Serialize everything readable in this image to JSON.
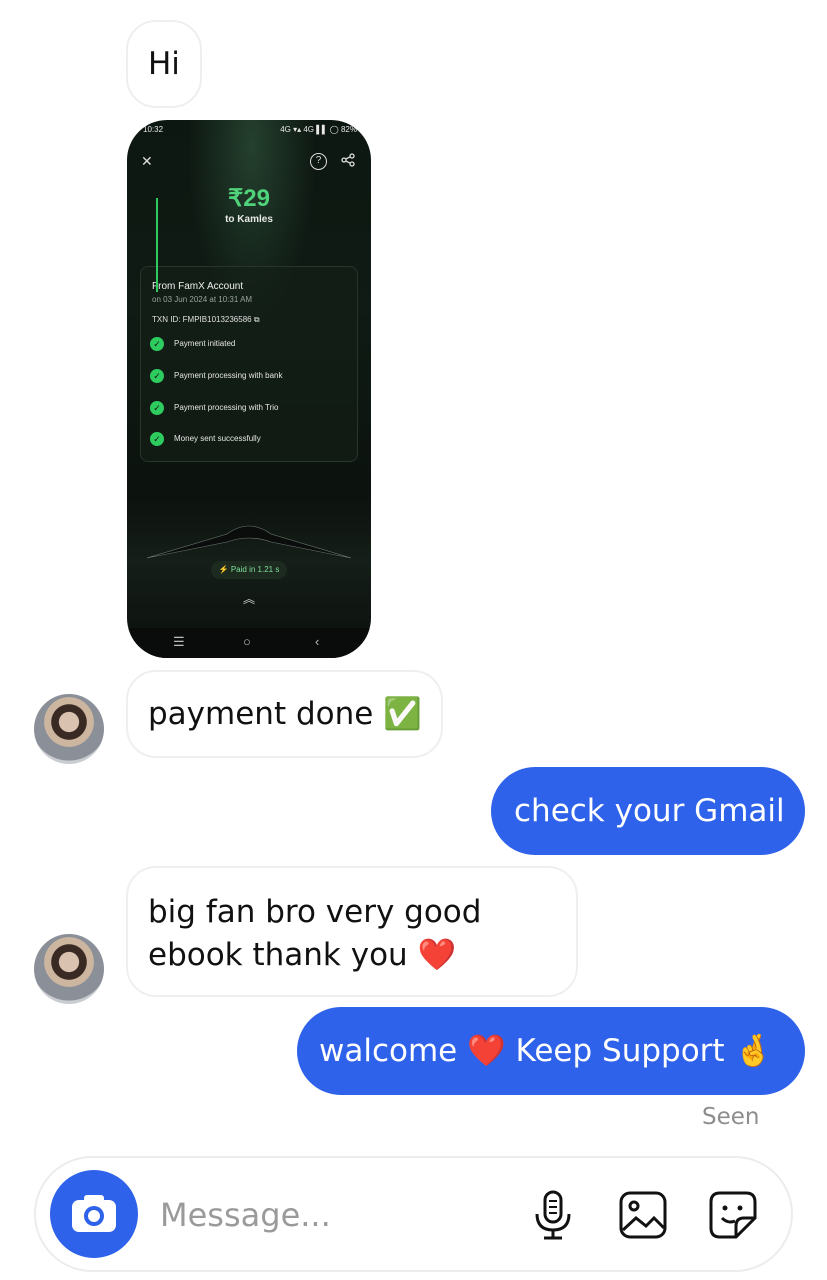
{
  "messages": [
    {
      "from": "them",
      "text": "Hi"
    },
    {
      "from": "them",
      "type": "image",
      "label": "payment screenshot"
    },
    {
      "from": "them",
      "text": "payment done ✅"
    },
    {
      "from": "me",
      "text": "check your Gmail"
    },
    {
      "from": "them",
      "text_line1": "big fan bro very good",
      "text_line2": "ebook thank you ❤️"
    },
    {
      "from": "me",
      "text": "walcome ❤️ Keep Support 🤞"
    }
  ],
  "screenshot": {
    "status_time": "10:32",
    "status_right": "4G ▾▴ 4G ▌▌ ◯ 82%",
    "amount": "₹29",
    "to": "to Kamles",
    "from": "From FamX Account",
    "date": "on 03 Jun 2024 at 10:31 AM",
    "txn": "TXN ID: FMPIB1013236586 ⧉",
    "steps": [
      "Payment initiated",
      "Payment processing with bank",
      "Payment processing with Trio",
      "Money sent successfully"
    ],
    "paid": "⚡ Paid in 1.21 s",
    "nav": [
      "☰",
      "○",
      "‹"
    ]
  },
  "receipt": "Seen",
  "composer": {
    "placeholder": "Message..."
  },
  "colors": {
    "outgoing": "#2f62ea",
    "check": "#2ecc5f"
  },
  "icons": [
    "camera-icon",
    "microphone-icon",
    "gallery-icon",
    "sticker-icon"
  ]
}
